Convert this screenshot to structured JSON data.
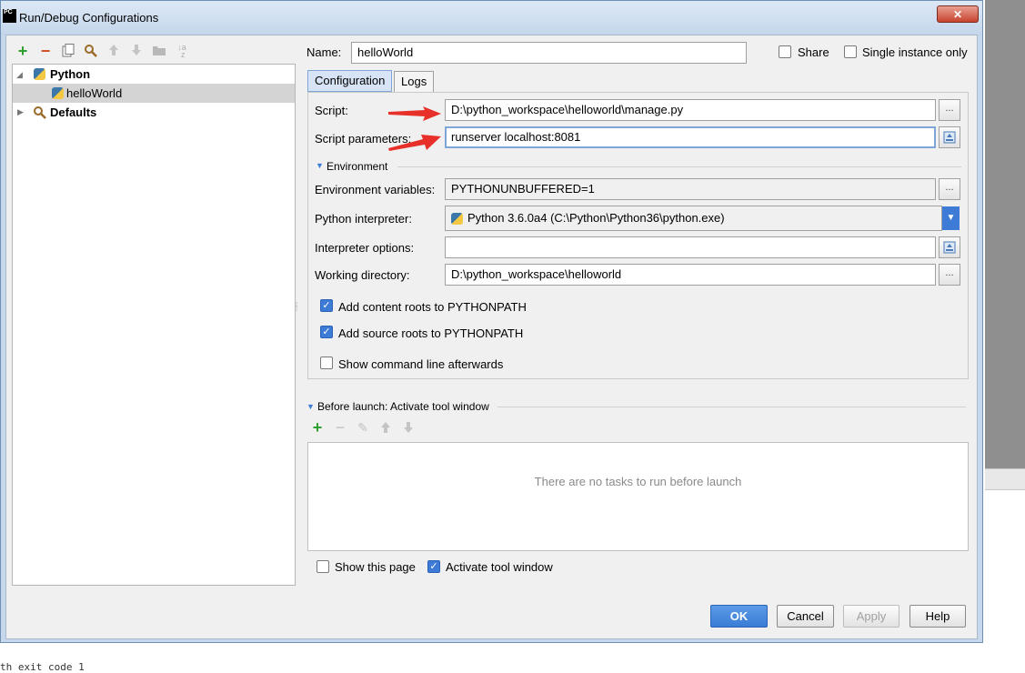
{
  "window": {
    "title": "Run/Debug Configurations",
    "app_icon_text": "PC",
    "close_symbol": "✕"
  },
  "background": {
    "bottom_text": "th exit code 1"
  },
  "toolbar": {
    "icons": [
      "add-icon",
      "remove-icon",
      "copy-icon",
      "settings-icon",
      "move-up-icon",
      "move-down-icon",
      "folder-icon",
      "sort-icon"
    ]
  },
  "tree": {
    "items": [
      {
        "label": "Python",
        "icon": "python-icon",
        "expanded": true
      },
      {
        "label": "helloWorld",
        "icon": "python-icon",
        "selected": true
      },
      {
        "label": "Defaults",
        "icon": "wrench-icon",
        "expanded": false
      }
    ]
  },
  "name_row": {
    "label": "Name:",
    "value": "helloWorld",
    "share_label": "Share",
    "single_instance_label": "Single instance only"
  },
  "tabs": [
    {
      "label": "Configuration",
      "active": true
    },
    {
      "label": "Logs",
      "active": false
    }
  ],
  "config": {
    "script_label": "Script:",
    "script_value": "D:\\python_workspace\\helloworld\\manage.py",
    "params_label": "Script parameters:",
    "params_value": "runserver localhost:8081",
    "environment_section": "Environment",
    "env_vars_label": "Environment variables:",
    "env_vars_value": "PYTHONUNBUFFERED=1",
    "interpreter_label": "Python interpreter:",
    "interpreter_value": "Python 3.6.0a4 (C:\\Python\\Python36\\python.exe)",
    "interp_options_label": "Interpreter options:",
    "interp_options_value": "",
    "workdir_label": "Working directory:",
    "workdir_value": "D:\\python_workspace\\helloworld",
    "add_content_roots_label": "Add content roots to PYTHONPATH",
    "add_source_roots_label": "Add source roots to PYTHONPATH",
    "show_cmd_label": "Show command line afterwards",
    "browse_symbol": "..."
  },
  "before_launch": {
    "section_label": "Before launch: Activate tool window",
    "empty_text": "There are no tasks to run before launch"
  },
  "footer": {
    "show_page_label": "Show this page",
    "activate_tool_label": "Activate tool window",
    "ok": "OK",
    "cancel": "Cancel",
    "apply": "Apply",
    "help": "Help"
  },
  "colors": {
    "accent": "#3d7bd6",
    "arrow": "#e8302a"
  }
}
